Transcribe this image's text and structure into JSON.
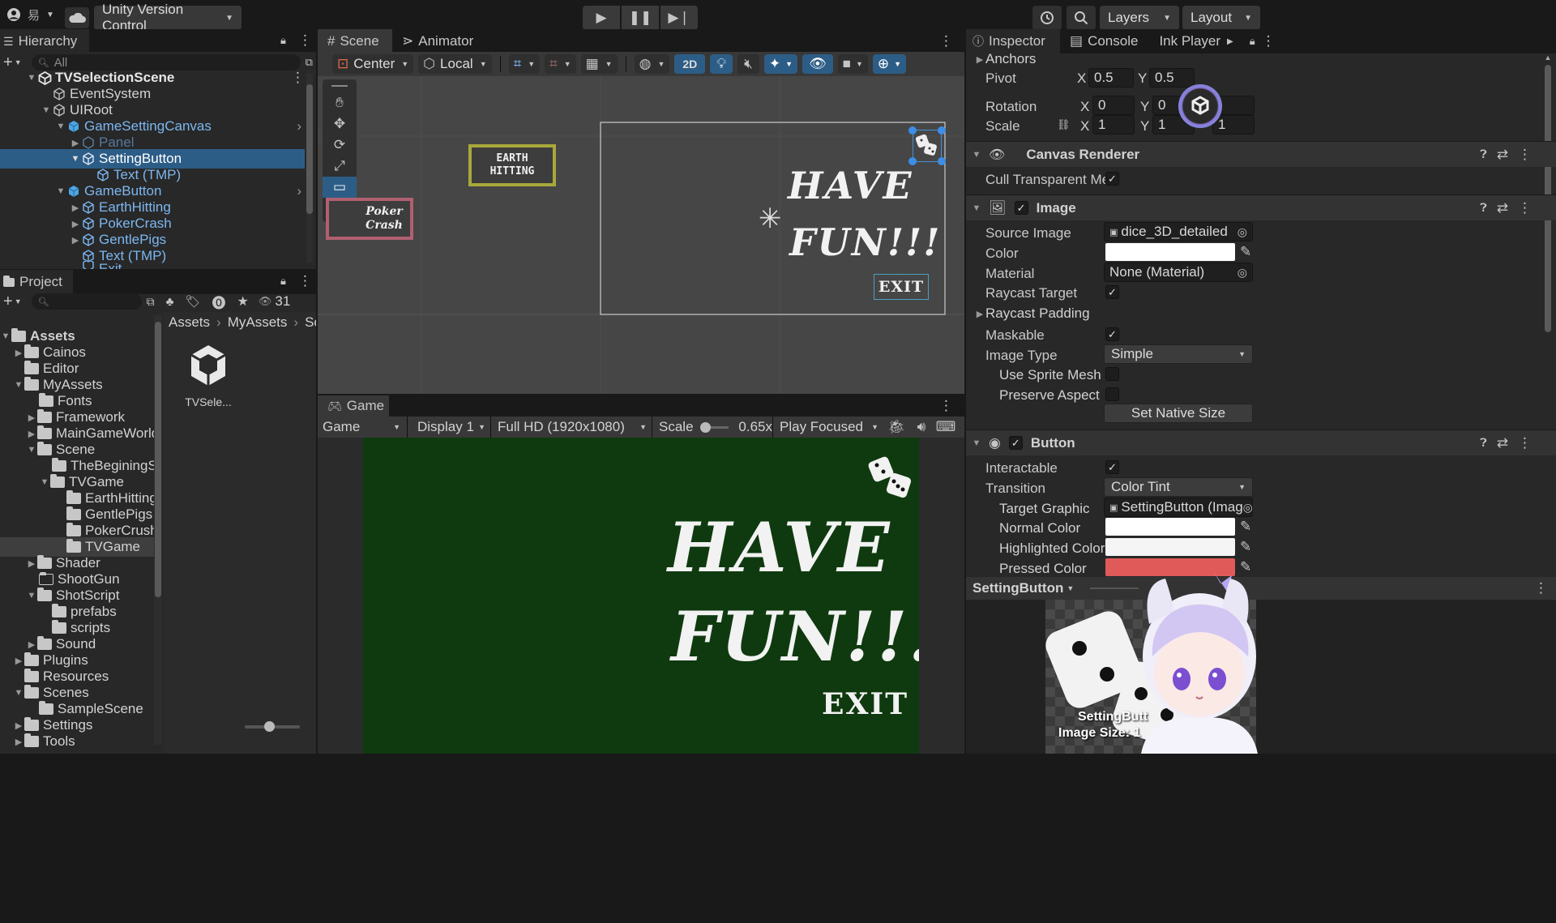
{
  "toolbar": {
    "account_glyph": "易",
    "version_control": "Unity Version Control",
    "layers": "Layers",
    "layout": "Layout"
  },
  "hierarchy": {
    "tab": "Hierarchy",
    "search_placeholder": "All",
    "items": [
      {
        "label": "TVSelectionScene",
        "depth": 0
      },
      {
        "label": "EventSystem",
        "depth": 1
      },
      {
        "label": "UIRoot",
        "depth": 1
      },
      {
        "label": "GameSettingCanvas",
        "depth": 2
      },
      {
        "label": "Panel",
        "depth": 3
      },
      {
        "label": "SettingButton",
        "depth": 3
      },
      {
        "label": "Text (TMP)",
        "depth": 4
      },
      {
        "label": "GameButton",
        "depth": 2
      },
      {
        "label": "EarthHitting",
        "depth": 3
      },
      {
        "label": "PokerCrash",
        "depth": 3
      },
      {
        "label": "GentlePigs",
        "depth": 3
      },
      {
        "label": "Text (TMP)",
        "depth": 3
      },
      {
        "label": "Exit",
        "depth": 3
      }
    ]
  },
  "project": {
    "tab": "Project",
    "count": "31",
    "breadcrumb": [
      "Assets",
      "MyAssets",
      "Sce"
    ],
    "tree": [
      {
        "label": "Assets"
      },
      {
        "label": "Cainos"
      },
      {
        "label": "Editor"
      },
      {
        "label": "MyAssets"
      },
      {
        "label": "Fonts"
      },
      {
        "label": "Framework"
      },
      {
        "label": "MainGameWorld"
      },
      {
        "label": "Scene"
      },
      {
        "label": "TheBeginingS"
      },
      {
        "label": "TVGame"
      },
      {
        "label": "EarthHitting"
      },
      {
        "label": "GentlePigs"
      },
      {
        "label": "PokerCrush"
      },
      {
        "label": "TVGame"
      },
      {
        "label": "Shader"
      },
      {
        "label": "ShootGun"
      },
      {
        "label": "ShotScript"
      },
      {
        "label": "prefabs"
      },
      {
        "label": "scripts"
      },
      {
        "label": "Sound"
      },
      {
        "label": "Plugins"
      },
      {
        "label": "Resources"
      },
      {
        "label": "Scenes"
      },
      {
        "label": "SampleScene"
      },
      {
        "label": "Settings"
      },
      {
        "label": "Tools"
      }
    ],
    "asset_label": "TVSele..."
  },
  "scene": {
    "tabs": [
      "Scene",
      "Animator"
    ],
    "pivot": "Center",
    "space": "Local",
    "mode_2d": "2D",
    "earth_hitting": "EARTH\nHITTING",
    "poker_crash": "Poker\nCrash",
    "have_fun_line1": "HAVE",
    "have_fun_line2": "FUN!!!",
    "exit": "EXIT"
  },
  "game": {
    "tab": "Game",
    "mode": "Game",
    "display": "Display 1",
    "resolution": "Full HD (1920x1080)",
    "scale_label": "Scale",
    "scale_value": "0.65x",
    "play_mode": "Play Focused",
    "have_fun_line1": "HAVE",
    "have_fun_line2": "FUN!!!",
    "exit": "EXIT"
  },
  "inspector": {
    "tabs": [
      "Inspector",
      "Console",
      "Ink Player"
    ],
    "anchors": "Anchors",
    "pivot": {
      "label": "Pivot",
      "x": "0.5",
      "y": "0.5"
    },
    "rotation": {
      "label": "Rotation",
      "x": "0",
      "y": "0"
    },
    "scale": {
      "label": "Scale",
      "x": "1",
      "y": "1",
      "z": "1"
    },
    "canvas_renderer": {
      "title": "Canvas Renderer",
      "cull": "Cull Transparent Mes"
    },
    "image": {
      "title": "Image",
      "source_label": "Source Image",
      "source_value": "dice_3D_detailed",
      "color_label": "Color",
      "material_label": "Material",
      "material_value": "None (Material)",
      "raycast_target": "Raycast Target",
      "raycast_padding": "Raycast Padding",
      "maskable": "Maskable",
      "image_type_label": "Image Type",
      "image_type_value": "Simple",
      "use_sprite_mesh": "Use Sprite Mesh",
      "preserve_aspect": "Preserve Aspect",
      "set_native_size": "Set Native Size"
    },
    "button": {
      "title": "Button",
      "interactable": "Interactable",
      "transition_label": "Transition",
      "transition_value": "Color Tint",
      "target_graphic_label": "Target Graphic",
      "target_graphic_value": "SettingButton (Imag",
      "normal_color": "Normal Color",
      "highlighted_color": "Highlighted Color",
      "pressed_color": "Pressed Color"
    },
    "preview": {
      "title": "SettingButton",
      "caption1": "SettingButt",
      "caption2": "Image Size: 1"
    }
  },
  "colors": {
    "pressed": "#e05a5a",
    "game_bg": "#0f3a0f",
    "selected_row": "#2c5d87",
    "accent_blue": "#4a8fd6"
  }
}
